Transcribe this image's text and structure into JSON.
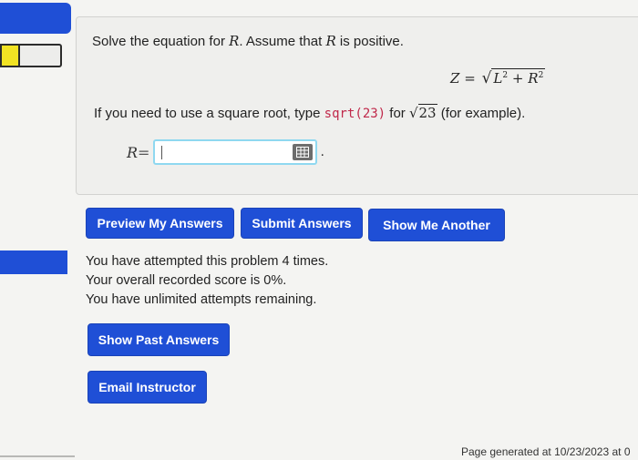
{
  "problem": {
    "intro_before": "Solve the equation for ",
    "intro_var": "R",
    "intro_after": ". Assume that ",
    "intro_var2": "R",
    "intro_end": " is positive.",
    "equation": {
      "lhs": "Z",
      "equals": "=",
      "term1": "L",
      "exp1": "2",
      "plus": "+",
      "term2": "R",
      "exp2": "2"
    },
    "instruction_before": "If you need to use a square root, type ",
    "instruction_code": "sqrt(23)",
    "instruction_mid": " for ",
    "instruction_sqrt_arg": "23",
    "instruction_after": " (for example)."
  },
  "answer": {
    "label_var": "R",
    "label_eq": "=",
    "value": "",
    "trailing": ".",
    "editor_icon": "equation-editor-grid-icon"
  },
  "buttons": {
    "preview": "Preview My Answers",
    "submit": "Submit Answers",
    "show_another": "Show Me Another",
    "show_past": "Show Past Answers",
    "email": "Email Instructor"
  },
  "status": {
    "attempts": "You have attempted this problem 4 times.",
    "score": "Your overall recorded score is 0%.",
    "remaining": "You have unlimited attempts remaining."
  },
  "footer": {
    "generated": "Page generated at 10/23/2023 at 0"
  },
  "colors": {
    "accent": "#1f4fd6",
    "code": "#c0284a",
    "field_border": "#8fd8f0",
    "nav_highlight": "#f2e323"
  }
}
